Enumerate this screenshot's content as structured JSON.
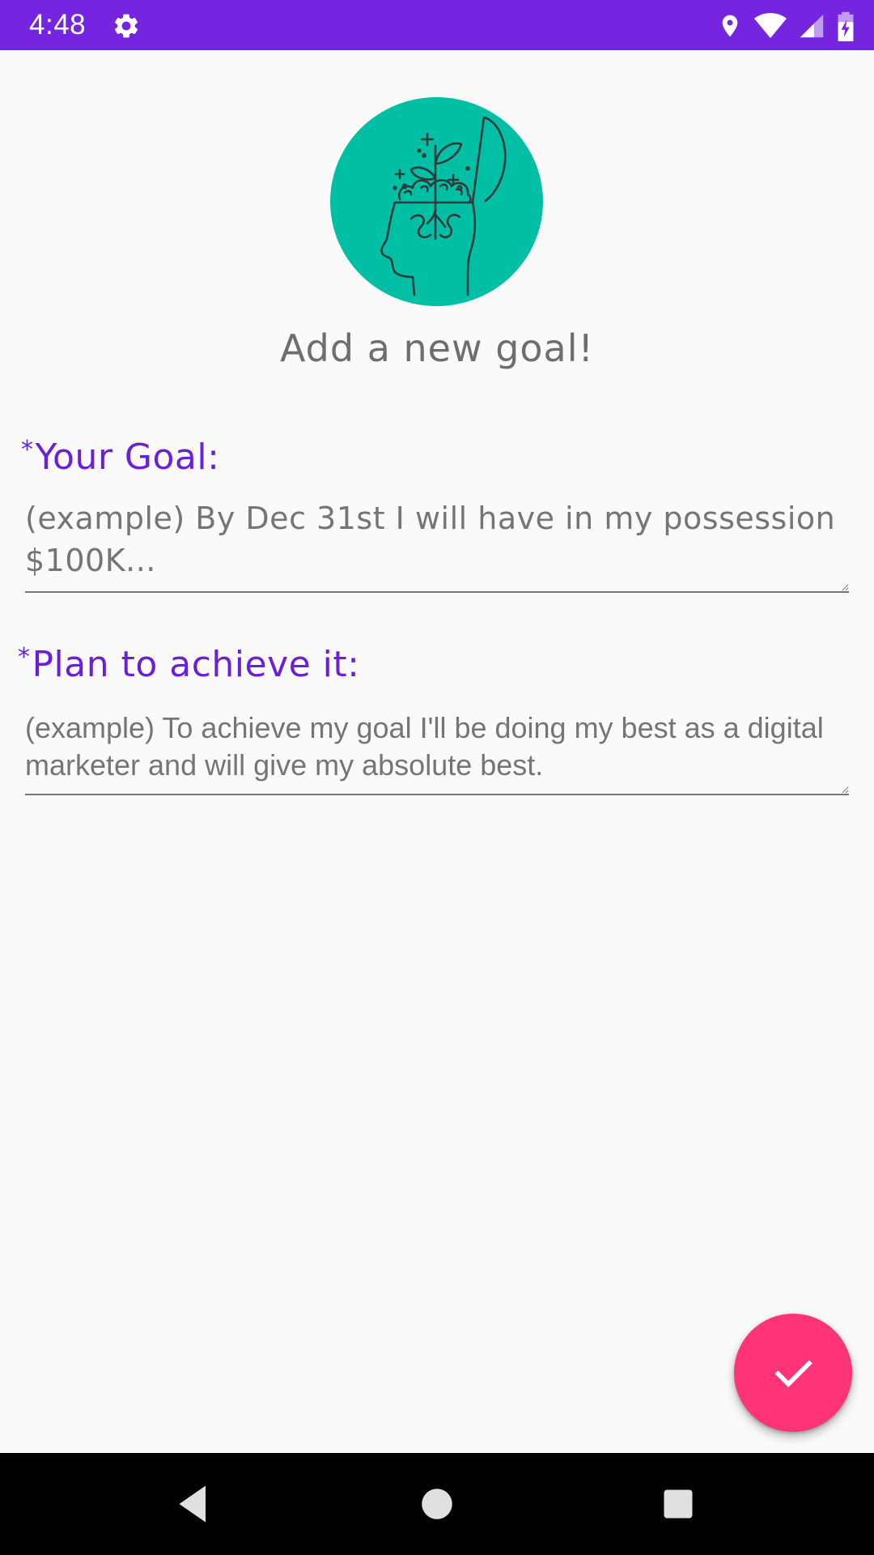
{
  "status_bar": {
    "time": "4:48",
    "icons": [
      "gear-icon",
      "location-icon",
      "wifi-icon",
      "cell-signal-icon",
      "battery-charging-icon"
    ],
    "background_color": "#7525e0"
  },
  "hero": {
    "icon": "growth-mind-head-icon",
    "circle_color": "#00bfa5"
  },
  "page": {
    "title": "Add a new goal!"
  },
  "form": {
    "required_marker": "*",
    "label_color": "#6a1fd8",
    "goal": {
      "label": "Your Goal:",
      "value": "",
      "placeholder": "(example) By Dec 31st I will have in my possession $100K..."
    },
    "plan": {
      "label": "Plan to achieve it:",
      "value": "",
      "placeholder": "(example) To achieve my goal I'll be doing my best as a digital marketer and will give my absolute best."
    }
  },
  "fab": {
    "icon": "checkmark-icon",
    "color": "#ff3377"
  },
  "nav_bar": {
    "icons": [
      "back-icon",
      "home-icon",
      "recents-icon"
    ]
  }
}
